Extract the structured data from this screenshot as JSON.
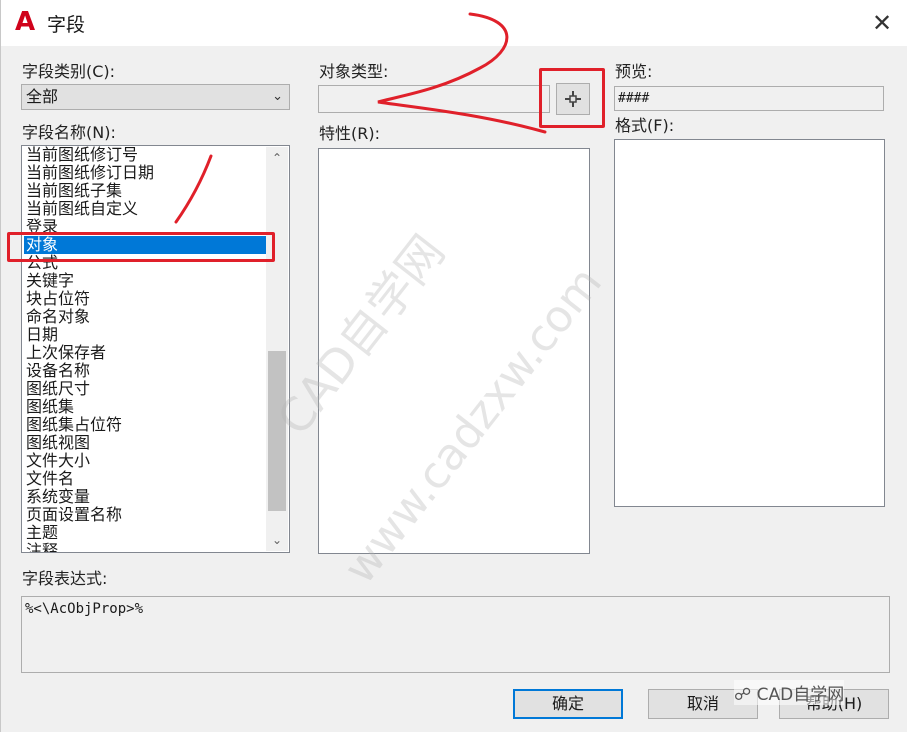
{
  "window": {
    "title": "字段",
    "close": "✕"
  },
  "category": {
    "label": "字段类别(C):",
    "value": "全部"
  },
  "field_names": {
    "label": "字段名称(N):",
    "items": [
      "当前图纸修订号",
      "当前图纸修订日期",
      "当前图纸子集",
      "当前图纸自定义",
      "登录",
      "对象",
      "公式",
      "关键字",
      "块占位符",
      "命名对象",
      "日期",
      "上次保存者",
      "设备名称",
      "图纸尺寸",
      "图纸集",
      "图纸集占位符",
      "图纸视图",
      "文件大小",
      "文件名",
      "系统变量",
      "页面设置名称",
      "主题",
      "注释"
    ],
    "selected": "对象"
  },
  "object_type": {
    "label": "对象类型:",
    "value": ""
  },
  "properties": {
    "label": "特性(R):"
  },
  "preview": {
    "label": "预览:",
    "value": "####"
  },
  "format": {
    "label": "格式(F):"
  },
  "expression": {
    "label": "字段表达式:",
    "value": "%<\\AcObjProp>%"
  },
  "buttons": {
    "ok": "确定",
    "cancel": "取消",
    "help": "帮助(H)"
  },
  "watermark": {
    "line1": "CAD自学网",
    "line2": "www.cadzxw.com",
    "badge": "CAD自学网"
  },
  "colors": {
    "selection": "#0078d7",
    "annotation": "#e0202a",
    "title_icon": "#d0021b"
  }
}
